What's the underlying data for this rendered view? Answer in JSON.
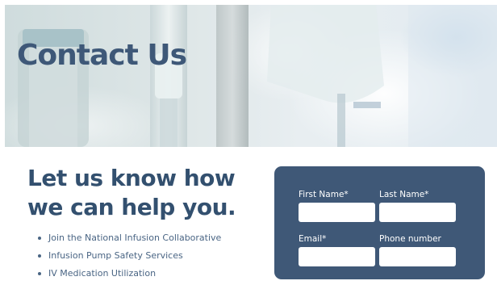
{
  "hero": {
    "title": "Contact Us"
  },
  "intro": {
    "heading_line1": "Let us know how",
    "heading_line2": "we can help you."
  },
  "services": {
    "items": [
      "Join the National Infusion Collaborative",
      "Infusion Pump Safety Services",
      "IV Medication Utilization"
    ]
  },
  "form": {
    "first_name_label": "First Name*",
    "first_name_value": "",
    "last_name_label": "Last Name*",
    "last_name_value": "",
    "email_label": "Email*",
    "email_value": "",
    "phone_label": "Phone number",
    "phone_value": ""
  },
  "colors": {
    "brand_navy": "#3f5877",
    "heading_blue": "#33506f",
    "text_blue": "#4a6584"
  }
}
